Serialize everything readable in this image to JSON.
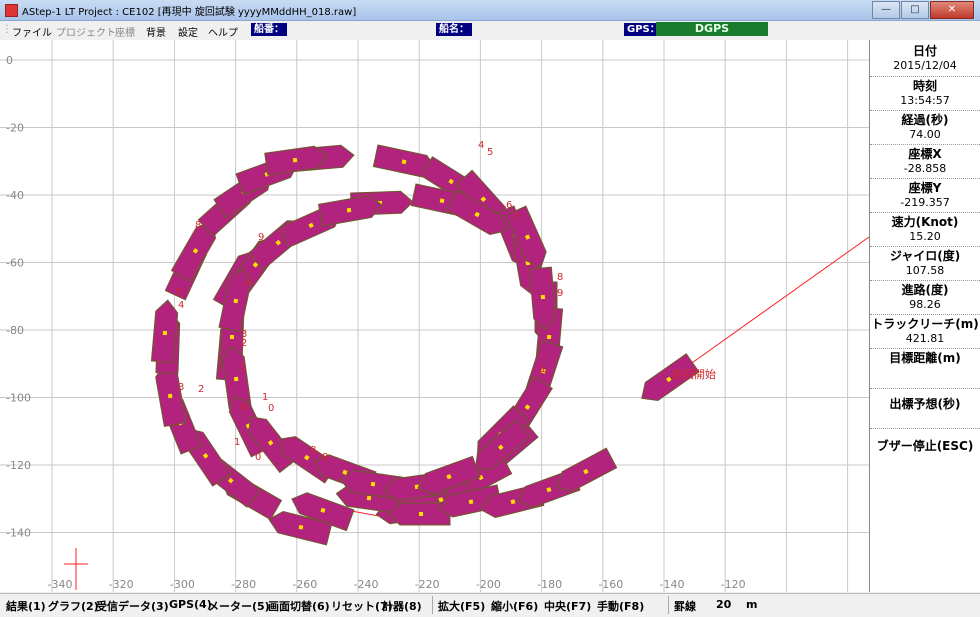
{
  "window": {
    "title": "AStep-1 LT  Project : CE102  [再現中 旋回試験 yyyyMMddHH_018.raw]"
  },
  "menu": {
    "items": [
      {
        "label": "ファイル",
        "enabled": true
      },
      {
        "label": "プロジェクト",
        "enabled": false
      },
      {
        "label": "座標",
        "enabled": false
      },
      {
        "label": "背景",
        "enabled": true
      },
      {
        "label": "設定",
        "enabled": true
      },
      {
        "label": "ヘルプ",
        "enabled": true
      }
    ],
    "ship_no_label": "船番：",
    "ship_name_label": "船名：",
    "gps_label": "GPS：",
    "gps_value": "DGPS"
  },
  "colors": {
    "ship_fill": "#b1237d",
    "ship_stroke": "#6e5b2a",
    "track": "#ff2020",
    "grid": "#c8c8c8",
    "gps_status": "#1a7d2e"
  },
  "plot": {
    "x_ticks": [
      "-340",
      "-320",
      "-300",
      "-280",
      "-260",
      "-240",
      "-220",
      "-200",
      "-180",
      "-160",
      "-140",
      "-120"
    ],
    "y_ticks": [
      "0",
      "-20",
      "-40",
      "-60",
      "-80",
      "-100",
      "-120",
      "-140"
    ],
    "start_label": "旋回開始",
    "ship_labels": [
      "1",
      "2",
      "3",
      "4",
      "5",
      "6",
      "7",
      "8",
      "9",
      "10",
      "11",
      "12",
      "13",
      "14",
      "15",
      "16",
      "17",
      "18",
      "19",
      "20",
      "21",
      "22",
      "23",
      "24",
      "25"
    ]
  },
  "panel": {
    "fields": [
      {
        "label": "日付",
        "value": "2015/12/04"
      },
      {
        "label": "時刻",
        "value": "13:54:57"
      },
      {
        "label": "経過(秒)",
        "value": "74.00"
      },
      {
        "label": "座標X",
        "value": "-28.858"
      },
      {
        "label": "座標Y",
        "value": "-219.357"
      },
      {
        "label": "速力(Knot)",
        "value": "15.20"
      },
      {
        "label": "ジャイロ(度)",
        "value": "107.58"
      },
      {
        "label": "進路(度)",
        "value": "98.26"
      },
      {
        "label": "トラックリーチ(m)",
        "value": "421.81"
      },
      {
        "label": "目標距離(m)",
        "value": ""
      },
      {
        "label": "出標予想(秒)",
        "value": ""
      }
    ],
    "buzzer_label": "ブザー停止(ESC)"
  },
  "status": {
    "left_items": [
      "結果(1)",
      "グラフ(2)",
      "受信データ(3)",
      "GPS(4)",
      "メーター(5)",
      "画面切替(6)",
      "リセット(7)",
      "計器(8)"
    ],
    "right_items": [
      "拡大(F5)",
      "縮小(F6)",
      "中央(F7)",
      "手動(F8)"
    ],
    "grid_label": "罫線",
    "grid_value": "20",
    "grid_unit": "m"
  }
}
